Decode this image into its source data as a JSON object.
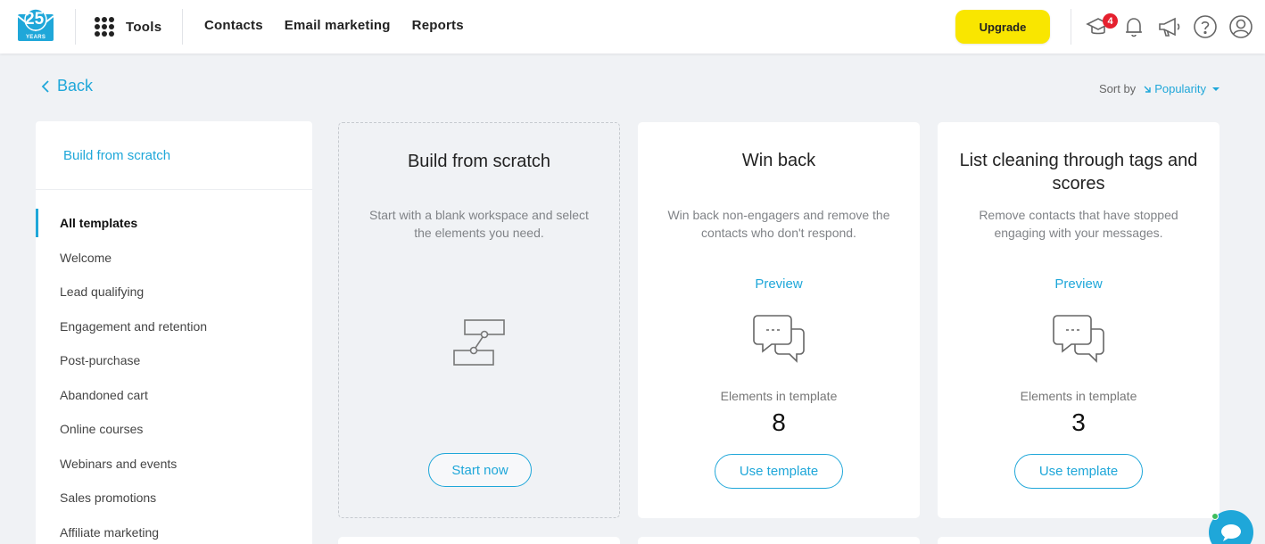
{
  "header": {
    "logo_text": "25",
    "logo_subtext": "YEARS",
    "tools_label": "Tools",
    "nav": [
      "Contacts",
      "Email marketing",
      "Reports"
    ],
    "upgrade_label": "Upgrade",
    "notification_count": "4",
    "icons": [
      "graduation-cap-icon",
      "bell-icon",
      "megaphone-icon",
      "help-icon",
      "user-icon"
    ]
  },
  "back_label": "Back",
  "sort": {
    "label": "Sort by",
    "value": "Popularity"
  },
  "sidebar": {
    "build_from_scratch": "Build from scratch",
    "items": [
      {
        "label": "All templates",
        "active": true
      },
      {
        "label": "Welcome"
      },
      {
        "label": "Lead qualifying"
      },
      {
        "label": "Engagement and retention"
      },
      {
        "label": "Post-purchase"
      },
      {
        "label": "Abandoned cart"
      },
      {
        "label": "Online courses"
      },
      {
        "label": "Webinars and events"
      },
      {
        "label": "Sales promotions"
      },
      {
        "label": "Affiliate marketing"
      }
    ]
  },
  "cards": [
    {
      "title": "Build from scratch",
      "description": "Start with a blank workspace and select the elements you need.",
      "button_label": "Start now",
      "icon": "workflow-icon"
    },
    {
      "title": "Win back",
      "description": "Win back non-engagers and remove the contacts who don't respond.",
      "preview_label": "Preview",
      "elements_label": "Elements in template",
      "elements_count": "8",
      "button_label": "Use template",
      "icon": "chat-bubbles-icon"
    },
    {
      "title": "List cleaning through tags and scores",
      "description": "Remove contacts that have stopped engaging with your messages.",
      "preview_label": "Preview",
      "elements_label": "Elements in template",
      "elements_count": "3",
      "button_label": "Use template",
      "icon": "chat-bubbles-icon"
    }
  ],
  "colors": {
    "accent": "#1fa7d9",
    "upgrade": "#f9e600",
    "badge": "#e5202e",
    "background": "#f0f2f5"
  }
}
